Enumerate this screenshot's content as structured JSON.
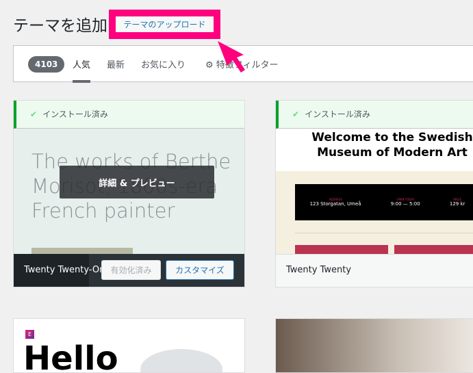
{
  "header": {
    "title": "テーマを追加",
    "upload_label": "テーマのアップロード"
  },
  "filter": {
    "count": "4103",
    "tabs": [
      "人気",
      "最新",
      "お気に入り"
    ],
    "feature_filter": "特徴フィルター"
  },
  "themes": [
    {
      "installed": "インストール済み",
      "preview_text": "The works of Berthe Morisot, 1800s-era French painter",
      "overlay": "詳細 & プレビュー",
      "name": "Twenty Twenty-One",
      "activated_label": "有効化済み",
      "customize_label": "カスタマイズ"
    },
    {
      "installed": "インストール済み",
      "heading": "Welcome to the Swedish Museum of Modern Art",
      "info": [
        {
          "label": "ADDRESS",
          "value": "123 Storgatan, Umeå"
        },
        {
          "label": "OPEN TODAY",
          "value": "9:00 — 5:00"
        },
        {
          "label": "PRICE",
          "value": "129 kr"
        }
      ],
      "name": "Twenty Twenty"
    },
    {
      "preview_text": "Hello"
    }
  ],
  "colors": {
    "accent": "#2271b1",
    "highlight": "#ff007f",
    "installed": "#00a32a"
  }
}
